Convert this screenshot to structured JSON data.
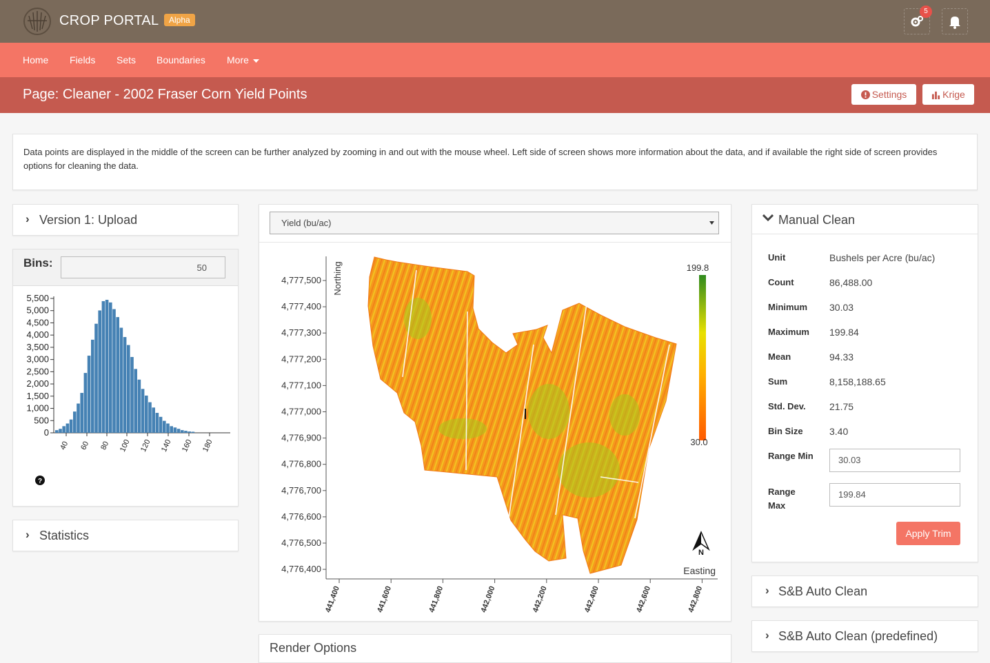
{
  "header": {
    "brand": "CROP PORTAL",
    "badge": "Alpha",
    "notification_count": "5"
  },
  "nav": {
    "items": [
      "Home",
      "Fields",
      "Sets",
      "Boundaries",
      "More"
    ]
  },
  "page": {
    "title": "Page: Cleaner - 2002 Fraser Corn Yield Points",
    "settings_label": "Settings",
    "krige_label": "Krige"
  },
  "intro": {
    "text": "Data points are displayed in the middle of the screen can be further analyzed by zooming in and out with the mouse wheel. Left side of screen shows more information about the data, and if available the right side of screen provides options for cleaning the data."
  },
  "left": {
    "version_label": "Version 1: Upload",
    "bins_label": "Bins:",
    "bins_value": "50",
    "statistics_label": "Statistics",
    "histogram": {
      "y_ticks": [
        "0",
        "500",
        "1,000",
        "1,500",
        "2,000",
        "2,500",
        "3,000",
        "3,500",
        "4,000",
        "4,500",
        "5,000",
        "5,500"
      ],
      "x_ticks": [
        "40",
        "60",
        "80",
        "100",
        "120",
        "140",
        "160",
        "180"
      ]
    }
  },
  "center": {
    "layer_select": "Yield (bu/ac)",
    "map": {
      "y_axis_label": "Northing",
      "x_axis_label": "Easting",
      "y_ticks": [
        "4,777,500",
        "4,777,400",
        "4,777,300",
        "4,777,200",
        "4,777,100",
        "4,777,000",
        "4,776,900",
        "4,776,800",
        "4,776,700",
        "4,776,600",
        "4,776,500",
        "4,776,400"
      ],
      "x_ticks": [
        "441,400",
        "441,600",
        "441,800",
        "442,000",
        "442,200",
        "442,400",
        "442,600",
        "442,800"
      ],
      "legend_max": "199.8",
      "legend_min": "30.0",
      "north_label": "N"
    },
    "render_options_label": "Render Options"
  },
  "right": {
    "manual_clean_label": "Manual Clean",
    "stats": [
      {
        "label": "Unit",
        "value": "Bushels per Acre (bu/ac)"
      },
      {
        "label": "Count",
        "value": "86,488.00"
      },
      {
        "label": "Minimum",
        "value": "30.03"
      },
      {
        "label": "Maximum",
        "value": "199.84"
      },
      {
        "label": "Mean",
        "value": "94.33"
      },
      {
        "label": "Sum",
        "value": "8,158,188.65"
      },
      {
        "label": "Std. Dev.",
        "value": "21.75"
      },
      {
        "label": "Bin Size",
        "value": "3.40"
      }
    ],
    "range_min_label": "Range Min",
    "range_min_value": "30.03",
    "range_max_label": "Range Max",
    "range_max_value": "199.84",
    "apply_label": "Apply Trim",
    "sb_auto_label": "S&B Auto Clean",
    "sb_auto_predef_label": "S&B Auto Clean (predefined)"
  },
  "colors": {
    "topbar": "#7a6a5a",
    "navbar": "#f47565",
    "pagebar": "#c55a4f",
    "bars": "#4682b4",
    "alpha_badge": "#f0a446"
  }
}
